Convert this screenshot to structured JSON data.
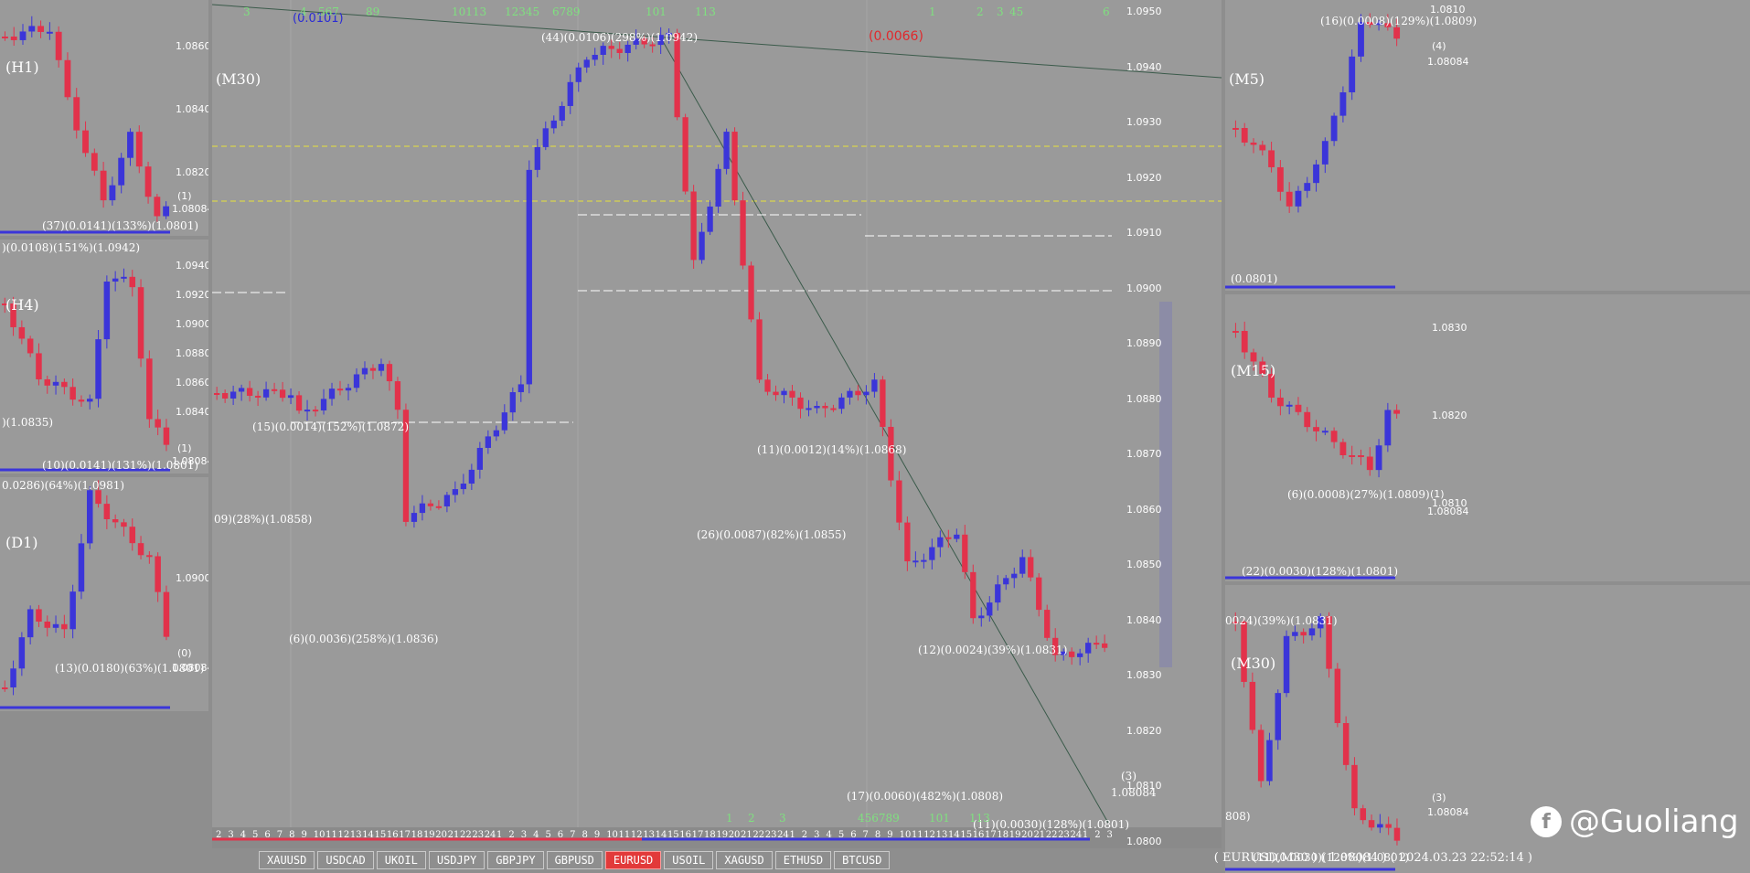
{
  "symbol_bar": {
    "tabs": [
      "XAUUSD",
      "USDCAD",
      "UKOIL",
      "USDJPY",
      "GBPJPY",
      "GBPUSD",
      "EURUSD",
      "USOIL",
      "XAGUSD",
      "ETHUSD",
      "BTCUSD"
    ],
    "active": "EURUSD"
  },
  "status": {
    "symbol": "( EURUSD,M30 )",
    "price": "( 1.08084 )",
    "datetime": "( 2024.03.23   22:52:14 )"
  },
  "watermark": {
    "text": "@Guoliang",
    "icon": "facebook-icon"
  },
  "main": {
    "timeframe": "(M30)",
    "top_label": "(0.0101)",
    "red_label": "(0.0066)",
    "top_counts": [
      "3",
      "4",
      "567",
      "89",
      "10113",
      "12345",
      "6789",
      "101",
      "113",
      "1",
      "2",
      "3",
      "45",
      "6"
    ],
    "bottom_counts": [
      "1",
      "2",
      "3",
      "456789",
      "101",
      "113"
    ],
    "price_axis": [
      "1.0950",
      "1.0940",
      "1.0930",
      "1.0920",
      "1.0910",
      "1.0900",
      "1.0890",
      "1.0880",
      "1.0870",
      "1.0860",
      "1.0850",
      "1.0840",
      "1.0830",
      "1.0820",
      "1.0810",
      "1.0800"
    ],
    "time_axis": [
      "2",
      "3",
      "4",
      "5",
      "6",
      "7",
      "8",
      "9",
      "10",
      "11",
      "12",
      "13",
      "14",
      "15",
      "16",
      "17",
      "18",
      "19",
      "20",
      "21",
      "22",
      "23",
      "24",
      "1",
      "2",
      "3",
      "4",
      "5",
      "6",
      "7",
      "8",
      "9",
      "10",
      "11",
      "12",
      "13",
      "14",
      "15",
      "16",
      "17",
      "18",
      "19",
      "20",
      "21",
      "22",
      "23",
      "24",
      "1",
      "2",
      "3",
      "4",
      "5",
      "6",
      "7",
      "8",
      "9",
      "10",
      "11",
      "12",
      "13",
      "14",
      "15",
      "16",
      "17",
      "18",
      "19",
      "20",
      "21",
      "22",
      "23",
      "24",
      "1",
      "2",
      "3"
    ],
    "annotations": [
      "(44)(0.0106)(298%)(1.0942)",
      "(15)(0.0014)(152%)(1.0872)",
      "09)(28%)(1.0858)",
      "(6)(0.0036)(258%)(1.0836)",
      "(11)(0.0012)(14%)(1.0868)",
      "(26)(0.0087)(82%)(1.0855)",
      "(12)(0.0024)(39%)(1.0831)",
      "(17)(0.0060)(482%)(1.0808)",
      "(11)(0.0030)(128%)(1.0801)",
      "(3)",
      "1.08084"
    ]
  },
  "panes": {
    "h1": {
      "label": "(H1)",
      "note": "(37)(0.0141)(133%)(1.0801)",
      "prices": [
        "1.0860",
        "1.0840",
        "1.0820",
        "1.0808"
      ],
      "tag": "(1)",
      "last": "1.08084"
    },
    "h4": {
      "label": "(H4)",
      "note_top": ")(0.0108)(151%)(1.0942)",
      "note_mid": ")(1.0835)",
      "note": "(10)(0.0141)(131%)(1.0801)",
      "prices": [
        "1.0940",
        "1.0920",
        "1.0900",
        "1.0880",
        "1.0860",
        "1.0840"
      ],
      "tag": "(1)",
      "last": "1.08084"
    },
    "d1": {
      "label": "(D1)",
      "note_top": "0.0286)(64%)(1.0981)",
      "note": "(13)(0.0180)(63%)(1.0801)",
      "prices": [
        "1.0900"
      ],
      "tag": "(0)",
      "last": "1.08084"
    },
    "m5": {
      "label": "(M5)",
      "note_top": "(16)(0.0008)(129%)(1.0809)",
      "note": "(0.0801)",
      "prices": [
        "1.0810",
        "1.0808"
      ],
      "tag": "(4)",
      "last": "1.08084"
    },
    "m15": {
      "label": "(M15)",
      "note_mid": "(6)(0.0008)(27%)(1.0809)",
      "note": "(22)(0.0030)(128%)(1.0801)",
      "prices": [
        "1.0830",
        "1.0820",
        "1.0810",
        "1.0808"
      ],
      "tag": "(1)",
      "last": "1.08084"
    },
    "m30": {
      "label": "(M30)",
      "note_top": "0024)(39%)(1.0831)",
      "note_left": "808)",
      "note": "(11)(0.0030)(128%)(1.0801)",
      "tag": "(3)",
      "last": "1.08084"
    }
  },
  "colors": {
    "bull": "#3b35d9",
    "bear": "#e2324b",
    "bg": "#9a9a9a",
    "fib": "#e8e23a"
  }
}
